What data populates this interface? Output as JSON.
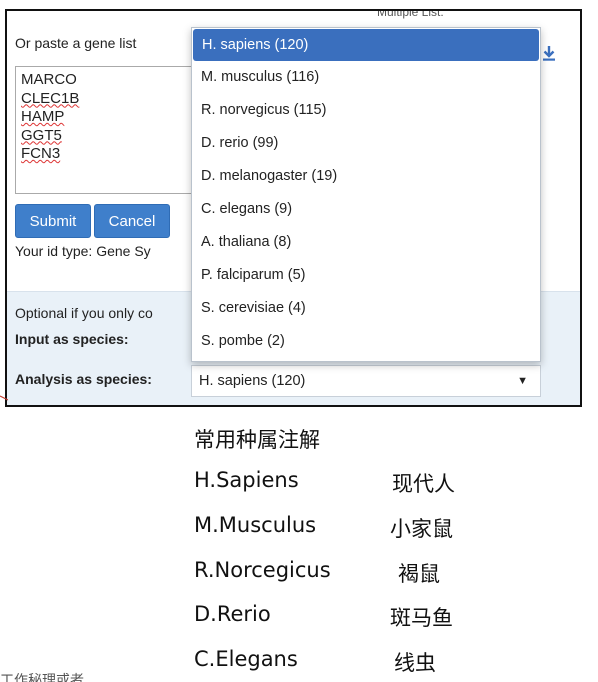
{
  "form": {
    "multiple_list_label": "Multiple List:",
    "paste_label": "Or paste a gene list",
    "genes": [
      "MARCO",
      "CLEC1B",
      "HAMP",
      "GGT5",
      "FCN3"
    ],
    "submit_label": "Submit",
    "cancel_label": "Cancel",
    "id_type_text": "Your id type: Gene Sy",
    "optional_text": "Optional if you only co",
    "input_species_label": "Input as species:",
    "analysis_species_label": "Analysis as species:",
    "analysis_species_value": "H. sapiens (120)",
    "select_arrow": "▼"
  },
  "dropdown": {
    "options": [
      "H. sapiens (120)",
      "M. musculus (116)",
      "R. norvegicus (115)",
      "D. rerio (99)",
      "D. melanogaster (19)",
      "C. elegans (9)",
      "A. thaliana (8)",
      "P. falciparum (5)",
      "S. cerevisiae (4)",
      "S. pombe (2)"
    ],
    "selected_index": 0
  },
  "notes": {
    "heading": "常用种属注解",
    "rows": [
      {
        "latin": "H.Sapiens",
        "chinese": "现代人"
      },
      {
        "latin": "M.Musculus",
        "chinese": "小家鼠"
      },
      {
        "latin": "R.Norcegicus",
        "chinese": "褐鼠"
      },
      {
        "latin": "D.Rerio",
        "chinese": "斑马鱼"
      },
      {
        "latin": "C.Elegans",
        "chinese": "线虫"
      }
    ],
    "cut_text": "工作秘理或者"
  },
  "colors": {
    "accent": "#3f7fcb",
    "selected_bg": "#3a6fbe",
    "panel_bottom": "#e9f1f8"
  }
}
